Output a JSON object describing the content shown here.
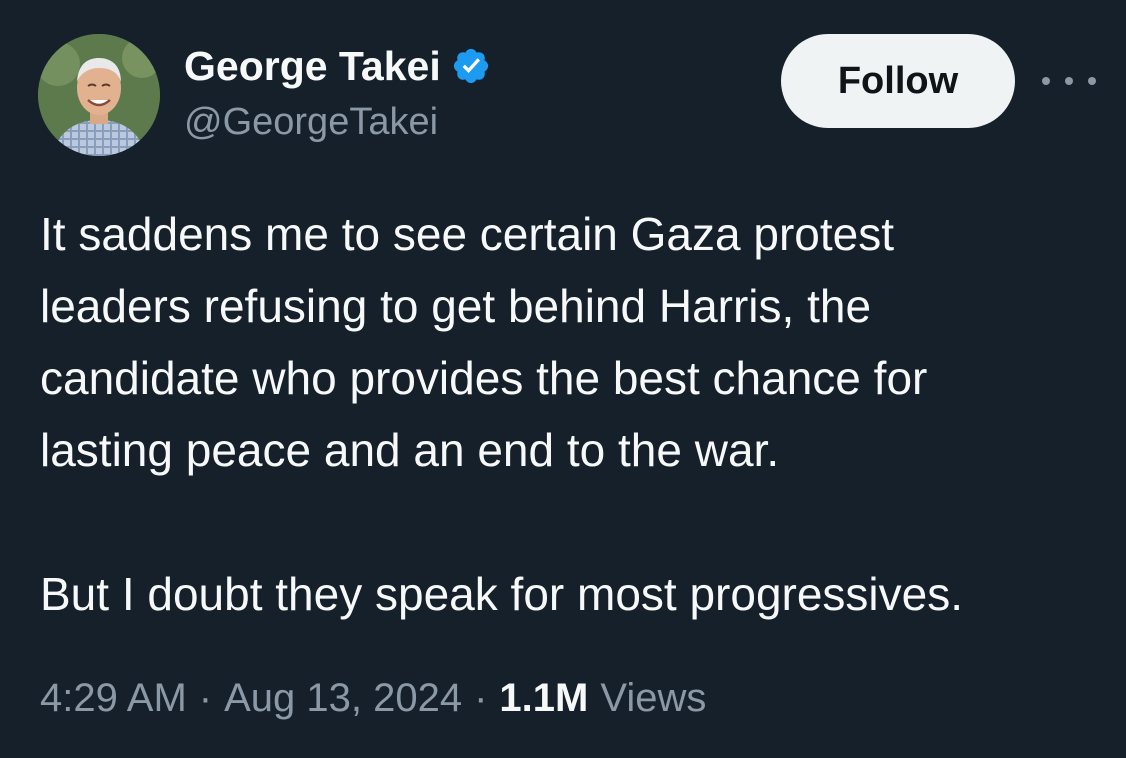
{
  "author": {
    "display_name": "George Takei",
    "handle": "@GeorgeTakei",
    "verified": true,
    "avatar_icon": "profile-photo",
    "verified_color": "#1d9bf0"
  },
  "actions": {
    "follow_label": "Follow",
    "more_icon": "more-horizontal-icon"
  },
  "tweet": {
    "paragraph_1_lines": [
      "It saddens me to see certain Gaza protest",
      "leaders refusing to get behind Harris, the",
      "candidate who provides the best chance for",
      "lasting peace and an end to the war."
    ],
    "paragraph_2": "But I doubt they speak for most progressives."
  },
  "meta": {
    "time": "4:29 AM",
    "separator": "·",
    "date": "Aug 13, 2024",
    "views_count": "1.1M",
    "views_label": "Views"
  },
  "colors": {
    "background": "#15202b",
    "text_primary": "#f7f9f9",
    "text_secondary": "#8b98a5",
    "button_bg": "#eff3f4",
    "button_text": "#0f1419"
  }
}
